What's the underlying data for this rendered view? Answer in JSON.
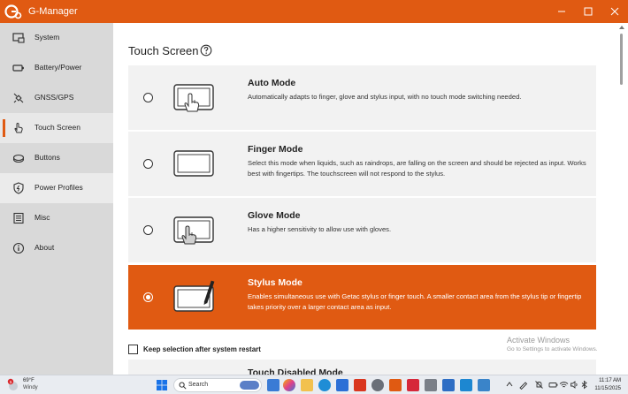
{
  "app": {
    "title": "G-Manager",
    "accent_color": "#e05a12"
  },
  "window_controls": {
    "minimize": "minimize-icon",
    "maximize": "maximize-icon",
    "close": "close-icon"
  },
  "sidebar": {
    "items": [
      {
        "label": "System",
        "icon": "system-icon"
      },
      {
        "label": "Battery/Power",
        "icon": "battery-icon"
      },
      {
        "label": "GNSS/GPS",
        "icon": "satellite-icon"
      },
      {
        "label": "Touch Screen",
        "icon": "touch-hand-icon",
        "active": true
      },
      {
        "label": "Buttons",
        "icon": "buttons-icon"
      },
      {
        "label": "Power Profiles",
        "icon": "shield-icon"
      },
      {
        "label": "Misc",
        "icon": "misc-icon"
      },
      {
        "label": "About",
        "icon": "info-icon"
      }
    ]
  },
  "main": {
    "title": "Touch Screen",
    "help_icon": "help-icon",
    "modes": [
      {
        "title": "Auto Mode",
        "description": "Automatically adapts to finger, glove and stylus input, with no touch mode switching needed.",
        "selected": false
      },
      {
        "title": "Finger Mode",
        "description": "Select this mode when liquids, such as raindrops, are falling on the screen and should be rejected as input. Works best with fingertips. The touchscreen will not respond to the stylus.",
        "selected": false
      },
      {
        "title": "Glove Mode",
        "description": "Has a higher sensitivity to allow use with gloves.",
        "selected": false
      },
      {
        "title": "Stylus Mode",
        "description": "Enables simultaneous use with Getac stylus or finger touch. A smaller contact area from the stylus tip or fingertip takes priority over a larger contact area as input.",
        "selected": true
      }
    ],
    "keep_selection_label": "Keep selection after system restart",
    "keep_selection_checked": false,
    "next_section_title": "Touch Disabled Mode"
  },
  "watermark": {
    "title": "Activate Windows",
    "subtitle": "Go to Settings to activate Windows."
  },
  "taskbar": {
    "weather_temp": "69°F",
    "weather_desc": "Windy",
    "weather_badge": "1",
    "search_placeholder": "Search",
    "time": "11:17 AM",
    "date": "11/15/2025"
  }
}
